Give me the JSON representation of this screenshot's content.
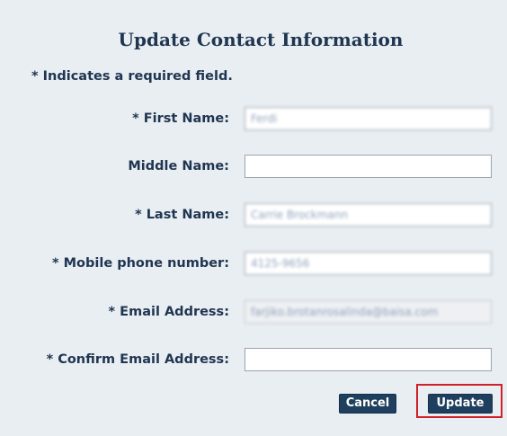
{
  "dialog": {
    "title": "Update Contact Information",
    "required_note": "* Indicates a required field."
  },
  "form": {
    "fields": [
      {
        "label": "* First Name:",
        "value": "Ferdi"
      },
      {
        "label": "Middle Name:",
        "value": ""
      },
      {
        "label": "* Last Name:",
        "value": "Carrie Brockmann"
      },
      {
        "label": "* Mobile phone number:",
        "value": "4125-9656"
      },
      {
        "label": "* Email Address:",
        "value": "farjiko.brotanrosalinda@baisa.com"
      },
      {
        "label": "* Confirm Email Address:",
        "value": ""
      }
    ]
  },
  "buttons": {
    "cancel": "Cancel",
    "update": "Update"
  },
  "colors": {
    "background": "#e9eef3",
    "text": "#1f3550",
    "button": "#1f3f5e",
    "highlight": "#d0202a"
  }
}
